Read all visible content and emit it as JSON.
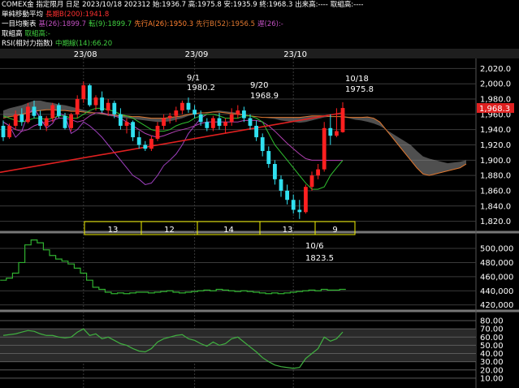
{
  "header": {
    "line1": {
      "title": "COMEX金 指定限月 日足",
      "info": "2023/10/18 202312 始:1936.7 高:1975.8 安:1935.9 終:1968.3 出来高:----",
      "extra": "取組高:----"
    },
    "line2": {
      "label": "単純移動平均",
      "ma200": "長期B(200):1941.8"
    },
    "line3": {
      "label": "一目均衡表",
      "base": "基(26):1899.7",
      "conv": "転(9):1899.7",
      "spanA": "先行A(26):1950.3",
      "spanB": "先行B(52):1956.5",
      "lag": "遅(26):-"
    },
    "line4": {
      "label": "取組高",
      "value": "取組高:-"
    },
    "line5": {
      "label": "RSI(相対力指数)",
      "value": "中期線(14):66.20"
    }
  },
  "colors": {
    "up": "#ff2020",
    "down": "#30e0f0",
    "ma200": "#e02020",
    "kumo": "#909090",
    "spanB": "#e07830",
    "conv": "#30c030",
    "base": "#b040b0",
    "lag": "#a040c0",
    "oi": "#30b030",
    "rsi": "#40b040",
    "grid": "#3a3a3a",
    "count_box": "#f0f000"
  },
  "price_axis": {
    "ticks": [
      "2,020.0",
      "2,000.0",
      "1,980.0",
      "1,960.0",
      "1,940.0",
      "1,920.0",
      "1,900.0",
      "1,880.0",
      "1,860.0",
      "1,840.0",
      "1,820.0"
    ],
    "current": "1,968.3"
  },
  "date_axis": {
    "labels": [
      "23/08",
      "23/09",
      "23/10"
    ]
  },
  "oi_axis": {
    "ticks": [
      "500,000",
      "480,000",
      "460,000",
      "440,000",
      "420,000"
    ]
  },
  "rsi_axis": {
    "ticks": [
      "80.00",
      "70.00",
      "60.00",
      "50.00",
      "40.00",
      "30.00",
      "20.00",
      "10.00"
    ]
  },
  "annotations": [
    {
      "date": "9/1",
      "price": "1980.2"
    },
    {
      "date": "9/20",
      "price": "1968.9"
    },
    {
      "date": "10/18",
      "price": "1975.8"
    },
    {
      "date": "10/6",
      "price": "1823.5"
    }
  ],
  "count_boxes": [
    "13",
    "12",
    "14",
    "13",
    "9"
  ],
  "chart_data": {
    "type": "candlestick",
    "ohlc": [
      [
        1945,
        1952,
        1925,
        1930
      ],
      [
        1930,
        1948,
        1928,
        1945
      ],
      [
        1945,
        1965,
        1940,
        1960
      ],
      [
        1960,
        1968,
        1945,
        1950
      ],
      [
        1950,
        1975,
        1948,
        1970
      ],
      [
        1970,
        1978,
        1955,
        1958
      ],
      [
        1958,
        1965,
        1940,
        1945
      ],
      [
        1945,
        1958,
        1938,
        1955
      ],
      [
        1955,
        1975,
        1950,
        1972
      ],
      [
        1972,
        1975,
        1955,
        1958
      ],
      [
        1958,
        1962,
        1940,
        1942
      ],
      [
        1942,
        1962,
        1938,
        1960
      ],
      [
        1960,
        1985,
        1955,
        1980
      ],
      [
        1980,
        2003,
        1975,
        1998
      ],
      [
        1998,
        2000,
        1970,
        1972
      ],
      [
        1972,
        1985,
        1965,
        1982
      ],
      [
        1982,
        1990,
        1962,
        1965
      ],
      [
        1965,
        1980,
        1958,
        1975
      ],
      [
        1975,
        1978,
        1955,
        1960
      ],
      [
        1960,
        1968,
        1940,
        1945
      ],
      [
        1945,
        1955,
        1935,
        1950
      ],
      [
        1950,
        1952,
        1925,
        1930
      ],
      [
        1930,
        1938,
        1915,
        1920
      ],
      [
        1920,
        1925,
        1912,
        1915
      ],
      [
        1915,
        1932,
        1912,
        1928
      ],
      [
        1928,
        1950,
        1925,
        1945
      ],
      [
        1945,
        1960,
        1940,
        1955
      ],
      [
        1955,
        1962,
        1948,
        1958
      ],
      [
        1958,
        1970,
        1950,
        1965
      ],
      [
        1965,
        1978,
        1960,
        1975
      ],
      [
        1975,
        1982,
        1962,
        1966
      ],
      [
        1966,
        1972,
        1955,
        1960
      ],
      [
        1960,
        1965,
        1945,
        1950
      ],
      [
        1950,
        1955,
        1938,
        1942
      ],
      [
        1942,
        1958,
        1938,
        1955
      ],
      [
        1955,
        1962,
        1940,
        1945
      ],
      [
        1945,
        1955,
        1935,
        1950
      ],
      [
        1950,
        1968,
        1945,
        1960
      ],
      [
        1960,
        1972,
        1955,
        1965
      ],
      [
        1965,
        1970,
        1950,
        1955
      ],
      [
        1955,
        1960,
        1940,
        1945
      ],
      [
        1945,
        1952,
        1925,
        1930
      ],
      [
        1930,
        1935,
        1905,
        1912
      ],
      [
        1912,
        1918,
        1890,
        1895
      ],
      [
        1895,
        1900,
        1868,
        1875
      ],
      [
        1875,
        1880,
        1852,
        1860
      ],
      [
        1860,
        1868,
        1842,
        1848
      ],
      [
        1848,
        1855,
        1830,
        1835
      ],
      [
        1835,
        1848,
        1823,
        1832
      ],
      [
        1832,
        1868,
        1830,
        1865
      ],
      [
        1865,
        1885,
        1860,
        1880
      ],
      [
        1880,
        1895,
        1875,
        1888
      ],
      [
        1888,
        1950,
        1885,
        1942
      ],
      [
        1942,
        1960,
        1920,
        1932
      ],
      [
        1932,
        1968,
        1930,
        1938
      ],
      [
        1936.7,
        1975.8,
        1935.9,
        1968.3
      ]
    ],
    "ylim": [
      1810,
      2030
    ],
    "ma200": [
      [
        0,
        1884
      ],
      [
        55,
        1962
      ]
    ],
    "kumo_span_a": [
      1965,
      1968,
      1970,
      1972,
      1975,
      1978,
      1978,
      1976,
      1975,
      1973,
      1972,
      1970,
      1968,
      1966,
      1964,
      1962,
      1960,
      1958,
      1957,
      1956,
      1955,
      1954,
      1953,
      1952,
      1951,
      1950,
      1950,
      1951,
      1953,
      1955,
      1958,
      1960,
      1962,
      1963,
      1964,
      1965,
      1964,
      1963,
      1962,
      1960,
      1958,
      1957,
      1956,
      1955,
      1954,
      1952,
      1951,
      1950,
      1949,
      1950,
      1952,
      1954,
      1956,
      1957,
      1957,
      1956,
      1955,
      1953,
      1952,
      1950.3,
      1948,
      1945,
      1940,
      1935,
      1930,
      1925,
      1920,
      1912,
      1905,
      1902,
      1900,
      1898,
      1896,
      1897,
      1898,
      1900
    ],
    "kumo_span_b": [
      1955,
      1957,
      1958,
      1960,
      1962,
      1964,
      1965,
      1966,
      1966,
      1965,
      1965,
      1964,
      1964,
      1963,
      1962,
      1962,
      1961,
      1960,
      1959,
      1958,
      1958,
      1957,
      1957,
      1956,
      1955,
      1955,
      1955,
      1956,
      1957,
      1958,
      1960,
      1961,
      1962,
      1962,
      1963,
      1963,
      1962,
      1961,
      1960,
      1959,
      1958,
      1957,
      1956,
      1956,
      1956,
      1956,
      1956,
      1956,
      1956,
      1957,
      1958,
      1958,
      1958,
      1957,
      1957,
      1957,
      1956,
      1956,
      1956,
      1956.5,
      1955,
      1950,
      1940,
      1930,
      1920,
      1910,
      1900,
      1890,
      1882,
      1880,
      1882,
      1884,
      1886,
      1888,
      1890,
      1895
    ],
    "tenkan": [
      1958,
      1955,
      1952,
      1950,
      1952,
      1955,
      1955,
      1953,
      1955,
      1958,
      1958,
      1955,
      1955,
      1960,
      1965,
      1968,
      1968,
      1966,
      1964,
      1960,
      1958,
      1955,
      1950,
      1945,
      1940,
      1938,
      1938,
      1940,
      1945,
      1948,
      1950,
      1955,
      1958,
      1960,
      1960,
      1958,
      1955,
      1955,
      1955,
      1958,
      1958,
      1955,
      1950,
      1935,
      1920,
      1910,
      1900,
      1890,
      1880,
      1870,
      1862,
      1862,
      1865,
      1880,
      1890,
      1899.7
    ],
    "kijun": [
      1950,
      1945,
      1940,
      1938,
      1940,
      1945,
      1948,
      1950,
      1952,
      1955,
      1955,
      1953,
      1950,
      1952,
      1958,
      1962,
      1962,
      1960,
      1958,
      1955,
      1950,
      1945,
      1940,
      1935,
      1932,
      1930,
      1932,
      1935,
      1938,
      1940,
      1942,
      1945,
      1948,
      1950,
      1950,
      1950,
      1950,
      1950,
      1950,
      1952,
      1952,
      1952,
      1950,
      1945,
      1938,
      1930,
      1922,
      1915,
      1908,
      1902,
      1900,
      1900,
      1900,
      1899.7,
      1899.7,
      1899.7
    ],
    "chikou": [
      1950,
      1945,
      1930,
      1938,
      1960,
      1968,
      1955,
      1942,
      1948,
      1962,
      1958,
      1935,
      1940,
      1950,
      1945,
      1938,
      1930,
      1920,
      1910,
      1900,
      1890,
      1880,
      1875,
      1868,
      1870,
      1880,
      1893,
      1900,
      1908,
      1920,
      1935,
      1945,
      1955,
      1960
    ],
    "open_interest": [
      455,
      458,
      465,
      480,
      505,
      512,
      508,
      498,
      490,
      485,
      482,
      478,
      472,
      465,
      455,
      445,
      442,
      438,
      436,
      437,
      436,
      437,
      438,
      438,
      437,
      438,
      439,
      440,
      438,
      437,
      438,
      439,
      440,
      441,
      440,
      442,
      441,
      440,
      439,
      440,
      439,
      438,
      437,
      436,
      437,
      436,
      437,
      438,
      439,
      440,
      441,
      440,
      442,
      441,
      441,
      442
    ],
    "rsi": [
      62,
      63,
      64,
      66,
      68,
      67,
      64,
      62,
      62,
      60,
      59,
      60,
      66,
      70,
      62,
      64,
      58,
      60,
      56,
      52,
      50,
      46,
      43,
      42,
      46,
      54,
      58,
      60,
      62,
      63,
      58,
      56,
      52,
      49,
      54,
      50,
      52,
      58,
      60,
      54,
      48,
      42,
      35,
      30,
      26,
      24,
      23,
      22,
      23,
      34,
      40,
      46,
      60,
      55,
      58,
      66.2
    ],
    "oi_ylim": [
      415,
      515
    ],
    "rsi_ylim": [
      0,
      85
    ]
  }
}
